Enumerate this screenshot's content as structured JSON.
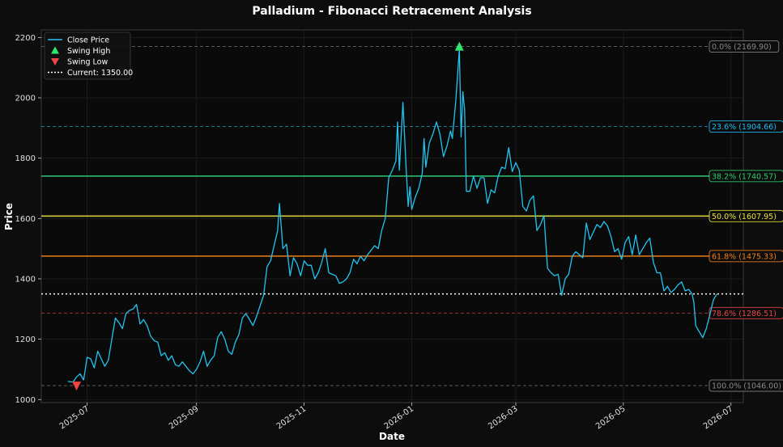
{
  "chart_data": {
    "type": "line",
    "title": "Palladium - Fibonacci Retracement Analysis",
    "xlabel": "Date",
    "ylabel": "Price",
    "ylim": [
      990,
      2225
    ],
    "xlim": [
      "2025-06-05",
      "2026-07-08"
    ],
    "y_ticks": [
      1000,
      1200,
      1400,
      1600,
      1800,
      2000,
      2200
    ],
    "x_ticks": [
      {
        "date": "2025-07-01",
        "label": "2025-07"
      },
      {
        "date": "2025-09-01",
        "label": "2025-09"
      },
      {
        "date": "2025-11-01",
        "label": "2025-11"
      },
      {
        "date": "2026-01-01",
        "label": "2026-01"
      },
      {
        "date": "2026-03-01",
        "label": "2026-03"
      },
      {
        "date": "2026-05-01",
        "label": "2026-05"
      },
      {
        "date": "2026-07-01",
        "label": "2026-07"
      }
    ],
    "grid": true,
    "legend_position": "top-left",
    "legend": [
      {
        "label": "Close Price",
        "kind": "line",
        "color": "#22c4f0"
      },
      {
        "label": "Swing High",
        "kind": "marker-up",
        "color": "#2ee86a"
      },
      {
        "label": "Swing Low",
        "kind": "marker-down",
        "color": "#ee4444"
      },
      {
        "label": "Current: 1350.00",
        "kind": "dotted",
        "color": "#ffffff"
      }
    ],
    "series": [
      {
        "name": "Close Price",
        "color": "#22c4f0",
        "points": [
          [
            "2025-06-20",
            1060
          ],
          [
            "2025-06-23",
            1058
          ],
          [
            "2025-06-25",
            1075
          ],
          [
            "2025-06-27",
            1085
          ],
          [
            "2025-06-29",
            1065
          ],
          [
            "2025-07-01",
            1140
          ],
          [
            "2025-07-03",
            1135
          ],
          [
            "2025-07-05",
            1105
          ],
          [
            "2025-07-07",
            1160
          ],
          [
            "2025-07-09",
            1135
          ],
          [
            "2025-07-11",
            1110
          ],
          [
            "2025-07-13",
            1130
          ],
          [
            "2025-07-15",
            1200
          ],
          [
            "2025-07-17",
            1270
          ],
          [
            "2025-07-19",
            1255
          ],
          [
            "2025-07-21",
            1235
          ],
          [
            "2025-07-23",
            1285
          ],
          [
            "2025-07-25",
            1295
          ],
          [
            "2025-07-27",
            1300
          ],
          [
            "2025-07-29",
            1315
          ],
          [
            "2025-07-31",
            1250
          ],
          [
            "2025-08-02",
            1265
          ],
          [
            "2025-08-04",
            1245
          ],
          [
            "2025-08-06",
            1210
          ],
          [
            "2025-08-08",
            1195
          ],
          [
            "2025-08-10",
            1190
          ],
          [
            "2025-08-12",
            1145
          ],
          [
            "2025-08-14",
            1155
          ],
          [
            "2025-08-16",
            1130
          ],
          [
            "2025-08-18",
            1145
          ],
          [
            "2025-08-20",
            1115
          ],
          [
            "2025-08-22",
            1110
          ],
          [
            "2025-08-24",
            1125
          ],
          [
            "2025-08-26",
            1110
          ],
          [
            "2025-08-28",
            1095
          ],
          [
            "2025-08-30",
            1085
          ],
          [
            "2025-09-01",
            1100
          ],
          [
            "2025-09-03",
            1125
          ],
          [
            "2025-09-05",
            1160
          ],
          [
            "2025-09-07",
            1110
          ],
          [
            "2025-09-09",
            1130
          ],
          [
            "2025-09-11",
            1145
          ],
          [
            "2025-09-13",
            1205
          ],
          [
            "2025-09-15",
            1225
          ],
          [
            "2025-09-17",
            1200
          ],
          [
            "2025-09-19",
            1160
          ],
          [
            "2025-09-21",
            1150
          ],
          [
            "2025-09-23",
            1190
          ],
          [
            "2025-09-25",
            1215
          ],
          [
            "2025-09-27",
            1270
          ],
          [
            "2025-09-29",
            1285
          ],
          [
            "2025-10-01",
            1265
          ],
          [
            "2025-10-03",
            1245
          ],
          [
            "2025-10-05",
            1275
          ],
          [
            "2025-10-07",
            1310
          ],
          [
            "2025-10-09",
            1345
          ],
          [
            "2025-10-11",
            1440
          ],
          [
            "2025-10-13",
            1460
          ],
          [
            "2025-10-15",
            1510
          ],
          [
            "2025-10-17",
            1560
          ],
          [
            "2025-10-18",
            1650
          ],
          [
            "2025-10-20",
            1500
          ],
          [
            "2025-10-22",
            1515
          ],
          [
            "2025-10-24",
            1410
          ],
          [
            "2025-10-26",
            1470
          ],
          [
            "2025-10-28",
            1450
          ],
          [
            "2025-10-30",
            1410
          ],
          [
            "2025-11-01",
            1460
          ],
          [
            "2025-11-03",
            1445
          ],
          [
            "2025-11-05",
            1445
          ],
          [
            "2025-11-07",
            1400
          ],
          [
            "2025-11-09",
            1420
          ],
          [
            "2025-11-11",
            1455
          ],
          [
            "2025-11-13",
            1500
          ],
          [
            "2025-11-15",
            1420
          ],
          [
            "2025-11-17",
            1415
          ],
          [
            "2025-11-19",
            1410
          ],
          [
            "2025-11-21",
            1385
          ],
          [
            "2025-11-23",
            1390
          ],
          [
            "2025-11-25",
            1400
          ],
          [
            "2025-11-27",
            1420
          ],
          [
            "2025-11-29",
            1465
          ],
          [
            "2025-12-01",
            1450
          ],
          [
            "2025-12-03",
            1475
          ],
          [
            "2025-12-05",
            1460
          ],
          [
            "2025-12-07",
            1480
          ],
          [
            "2025-12-09",
            1495
          ],
          [
            "2025-12-11",
            1510
          ],
          [
            "2025-12-13",
            1500
          ],
          [
            "2025-12-15",
            1560
          ],
          [
            "2025-12-17",
            1600
          ],
          [
            "2025-12-19",
            1735
          ],
          [
            "2025-12-21",
            1760
          ],
          [
            "2025-12-23",
            1790
          ],
          [
            "2025-12-24",
            1920
          ],
          [
            "2025-12-25",
            1760
          ],
          [
            "2025-12-27",
            1985
          ],
          [
            "2025-12-29",
            1750
          ],
          [
            "2025-12-30",
            1640
          ],
          [
            "2025-12-31",
            1705
          ],
          [
            "2026-01-01",
            1630
          ],
          [
            "2026-01-03",
            1670
          ],
          [
            "2026-01-05",
            1700
          ],
          [
            "2026-01-07",
            1750
          ],
          [
            "2026-01-08",
            1865
          ],
          [
            "2026-01-09",
            1770
          ],
          [
            "2026-01-11",
            1850
          ],
          [
            "2026-01-13",
            1880
          ],
          [
            "2026-01-15",
            1920
          ],
          [
            "2026-01-17",
            1880
          ],
          [
            "2026-01-19",
            1805
          ],
          [
            "2026-01-21",
            1840
          ],
          [
            "2026-01-23",
            1890
          ],
          [
            "2026-01-24",
            1865
          ],
          [
            "2026-01-26",
            1990
          ],
          [
            "2026-01-28",
            2160
          ],
          [
            "2026-01-29",
            1870
          ],
          [
            "2026-01-30",
            2020
          ],
          [
            "2026-01-31",
            1960
          ],
          [
            "2026-02-01",
            1690
          ],
          [
            "2026-02-03",
            1690
          ],
          [
            "2026-02-05",
            1740
          ],
          [
            "2026-02-07",
            1700
          ],
          [
            "2026-02-09",
            1735
          ],
          [
            "2026-02-11",
            1735
          ],
          [
            "2026-02-13",
            1650
          ],
          [
            "2026-02-15",
            1695
          ],
          [
            "2026-02-17",
            1685
          ],
          [
            "2026-02-19",
            1740
          ],
          [
            "2026-02-21",
            1770
          ],
          [
            "2026-02-23",
            1765
          ],
          [
            "2026-02-25",
            1835
          ],
          [
            "2026-02-27",
            1755
          ],
          [
            "2026-03-01",
            1785
          ],
          [
            "2026-03-03",
            1760
          ],
          [
            "2026-03-05",
            1640
          ],
          [
            "2026-03-07",
            1625
          ],
          [
            "2026-03-09",
            1660
          ],
          [
            "2026-03-11",
            1675
          ],
          [
            "2026-03-13",
            1560
          ],
          [
            "2026-03-15",
            1580
          ],
          [
            "2026-03-17",
            1610
          ],
          [
            "2026-03-19",
            1435
          ],
          [
            "2026-03-21",
            1420
          ],
          [
            "2026-03-23",
            1410
          ],
          [
            "2026-03-25",
            1415
          ],
          [
            "2026-03-27",
            1345
          ],
          [
            "2026-03-29",
            1400
          ],
          [
            "2026-03-31",
            1415
          ],
          [
            "2026-04-02",
            1475
          ],
          [
            "2026-04-04",
            1490
          ],
          [
            "2026-04-06",
            1480
          ],
          [
            "2026-04-08",
            1470
          ],
          [
            "2026-04-10",
            1585
          ],
          [
            "2026-04-12",
            1530
          ],
          [
            "2026-04-14",
            1555
          ],
          [
            "2026-04-16",
            1580
          ],
          [
            "2026-04-18",
            1570
          ],
          [
            "2026-04-20",
            1590
          ],
          [
            "2026-04-22",
            1575
          ],
          [
            "2026-04-24",
            1540
          ],
          [
            "2026-04-26",
            1490
          ],
          [
            "2026-04-28",
            1500
          ],
          [
            "2026-04-30",
            1465
          ],
          [
            "2026-05-02",
            1520
          ],
          [
            "2026-05-04",
            1540
          ],
          [
            "2026-05-06",
            1480
          ],
          [
            "2026-05-08",
            1545
          ],
          [
            "2026-05-10",
            1480
          ],
          [
            "2026-05-12",
            1500
          ],
          [
            "2026-05-14",
            1520
          ],
          [
            "2026-05-16",
            1535
          ],
          [
            "2026-05-18",
            1455
          ],
          [
            "2026-05-20",
            1420
          ],
          [
            "2026-05-22",
            1420
          ],
          [
            "2026-05-24",
            1360
          ],
          [
            "2026-05-26",
            1375
          ],
          [
            "2026-05-28",
            1355
          ],
          [
            "2026-05-30",
            1365
          ],
          [
            "2026-06-01",
            1380
          ],
          [
            "2026-06-03",
            1390
          ],
          [
            "2026-06-05",
            1360
          ],
          [
            "2026-06-07",
            1365
          ],
          [
            "2026-06-09",
            1350
          ],
          [
            "2026-06-10",
            1320
          ],
          [
            "2026-06-11",
            1245
          ],
          [
            "2026-06-13",
            1225
          ],
          [
            "2026-06-15",
            1205
          ],
          [
            "2026-06-17",
            1235
          ],
          [
            "2026-06-19",
            1280
          ],
          [
            "2026-06-21",
            1330
          ],
          [
            "2026-06-23",
            1350
          ]
        ]
      }
    ],
    "swing_high": {
      "date": "2026-01-28",
      "value": 2169.9,
      "color": "#2ee86a"
    },
    "swing_low": {
      "date": "2025-06-25",
      "value": 1046.0,
      "color": "#ee4444"
    },
    "current_price": {
      "value": 1350.0,
      "color": "#ffffff"
    },
    "fib_levels": [
      {
        "label": "0.0% (2169.90)",
        "value": 2169.9,
        "color": "#888888",
        "dashed": true
      },
      {
        "label": "23.6% (1904.66)",
        "value": 1904.66,
        "color": "#22b8f0",
        "dashed": true
      },
      {
        "label": "38.2% (1740.57)",
        "value": 1740.57,
        "color": "#2ecc71",
        "dashed": false
      },
      {
        "label": "50.0% (1607.95)",
        "value": 1607.95,
        "color": "#e8e040",
        "dashed": false
      },
      {
        "label": "61.8% (1475.33)",
        "value": 1475.33,
        "color": "#f0801a",
        "dashed": false
      },
      {
        "label": "78.6% (1286.51)",
        "value": 1286.51,
        "color": "#e84848",
        "dashed": true
      },
      {
        "label": "100.0% (1046.00)",
        "value": 1046.0,
        "color": "#888888",
        "dashed": true
      }
    ]
  }
}
